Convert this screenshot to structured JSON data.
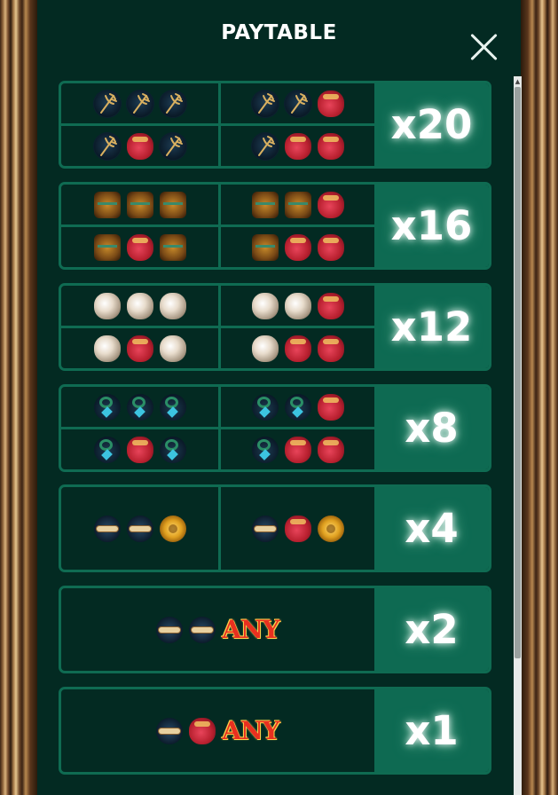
{
  "header": {
    "title": "PAYTABLE",
    "close_icon": "close-icon"
  },
  "rows": [
    {
      "multiplier": "x20",
      "combos": [
        [
          "trident",
          "trident",
          "trident"
        ],
        [
          "trident",
          "trident",
          "kraken"
        ],
        [
          "trident",
          "kraken",
          "trident"
        ],
        [
          "trident",
          "kraken",
          "kraken"
        ]
      ]
    },
    {
      "multiplier": "x16",
      "combos": [
        [
          "chest",
          "chest",
          "chest"
        ],
        [
          "chest",
          "chest",
          "kraken"
        ],
        [
          "chest",
          "kraken",
          "chest"
        ],
        [
          "chest",
          "kraken",
          "kraken"
        ]
      ]
    },
    {
      "multiplier": "x12",
      "combos": [
        [
          "pearl",
          "pearl",
          "pearl"
        ],
        [
          "pearl",
          "pearl",
          "kraken"
        ],
        [
          "pearl",
          "kraken",
          "pearl"
        ],
        [
          "pearl",
          "kraken",
          "kraken"
        ]
      ]
    },
    {
      "multiplier": "x8",
      "combos": [
        [
          "amulet",
          "amulet",
          "amulet"
        ],
        [
          "amulet",
          "amulet",
          "kraken"
        ],
        [
          "amulet",
          "kraken",
          "amulet"
        ],
        [
          "amulet",
          "kraken",
          "kraken"
        ]
      ]
    },
    {
      "multiplier": "x4",
      "combos": [
        [
          "scroll",
          "scroll",
          "coin"
        ],
        [
          "scroll",
          "kraken",
          "coin"
        ]
      ]
    },
    {
      "multiplier": "x2",
      "combos": [
        [
          "scroll",
          "scroll",
          "ANY"
        ]
      ]
    },
    {
      "multiplier": "x1",
      "combos": [
        [
          "scroll",
          "kraken",
          "ANY"
        ]
      ]
    }
  ],
  "any_label": "ANY",
  "colors": {
    "panel": "#032a22",
    "border": "#0f6b52",
    "multiplier_bg": "#0e6a52"
  }
}
